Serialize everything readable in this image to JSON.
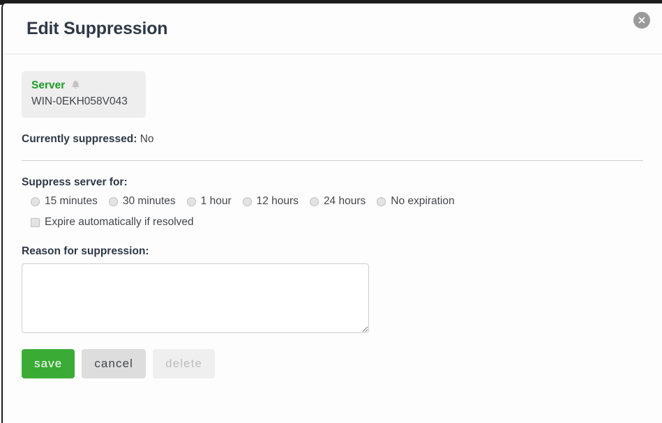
{
  "modal": {
    "title": "Edit Suppression",
    "close_icon": "close-circle-icon"
  },
  "server_chip": {
    "type_label": "Server",
    "bell_icon": "bell-icon",
    "name": "WIN-0EKH058V043"
  },
  "status": {
    "label": "Currently suppressed:",
    "value": "No"
  },
  "suppress": {
    "section_label": "Suppress server for:",
    "options": [
      {
        "label": "15 minutes",
        "selected": false
      },
      {
        "label": "30 minutes",
        "selected": false
      },
      {
        "label": "1 hour",
        "selected": false
      },
      {
        "label": "12 hours",
        "selected": false
      },
      {
        "label": "24 hours",
        "selected": false
      },
      {
        "label": "No expiration",
        "selected": false
      }
    ],
    "expire_checkbox_label": "Expire automatically if resolved",
    "expire_checked": false
  },
  "reason": {
    "label": "Reason for suppression:",
    "value": "",
    "placeholder": ""
  },
  "buttons": {
    "save": "save",
    "cancel": "cancel",
    "delete": "delete"
  },
  "colors": {
    "accent_green": "#3aab35",
    "server_green": "#1a9c26",
    "title": "#2e3947",
    "text": "#43464b",
    "chip_bg": "#eeeeee",
    "disabled_text": "#bcbcbc"
  }
}
